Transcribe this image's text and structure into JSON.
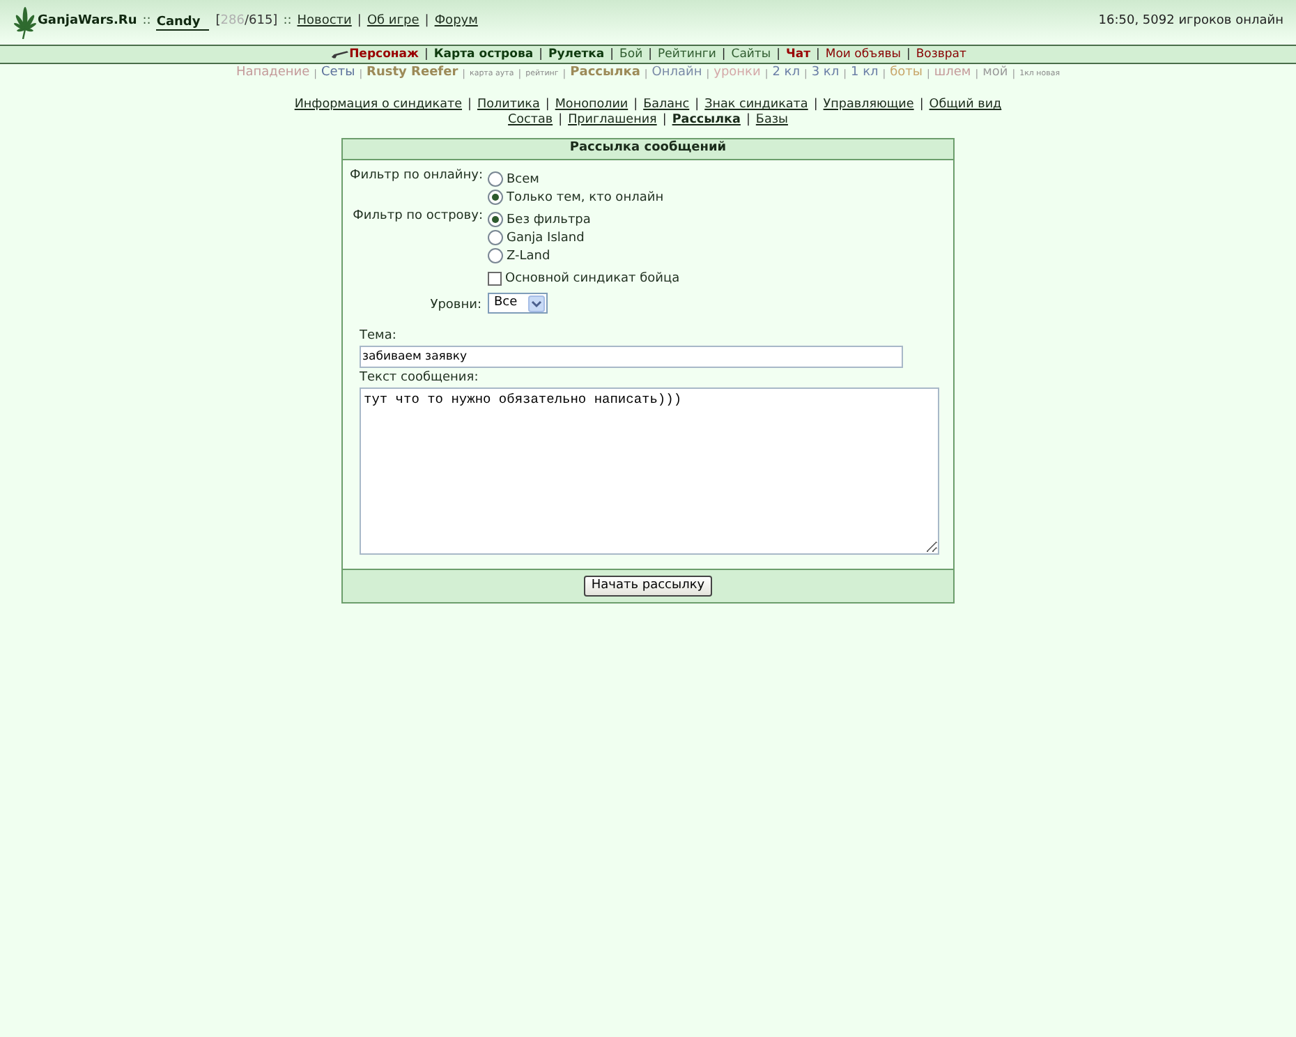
{
  "header": {
    "site_name": "GanjaWars.Ru",
    "dividers": [
      "::",
      "::"
    ],
    "player": {
      "name": "Candy",
      "hp": {
        "open": "[",
        "current": "286",
        "rest": "/615]"
      }
    },
    "link_separator": "|",
    "links": [
      "Новости",
      "Об игре",
      "Форум"
    ],
    "status": "16:50, 5092 игроков онлайн"
  },
  "main_nav": {
    "separator": "|",
    "items": [
      {
        "label": "Персонаж",
        "bold": true,
        "color": "#990000"
      },
      {
        "label": "Карта острова",
        "bold": true,
        "color": "#0f3a0f"
      },
      {
        "label": "Рулетка",
        "bold": true,
        "color": "#0f3a0f"
      },
      {
        "label": "Бой",
        "bold": false,
        "color": "#2d5a2d"
      },
      {
        "label": "Рейтинги",
        "bold": false,
        "color": "#2d5a2d"
      },
      {
        "label": "Сайты",
        "bold": false,
        "color": "#2d5a2d"
      },
      {
        "label": "Чат",
        "bold": true,
        "color": "#990000"
      },
      {
        "label": "Мои объявы",
        "bold": false,
        "color": "#880000"
      },
      {
        "label": "Возврат",
        "bold": false,
        "color": "#880000"
      }
    ]
  },
  "sub_nav": {
    "separator": "|",
    "items": [
      {
        "label": "Нападение",
        "kind": "normal",
        "color": "#c49a9a"
      },
      {
        "label": "Сеты",
        "kind": "normal",
        "color": "#5a6f9a"
      },
      {
        "label": "Rusty Reefer",
        "kind": "bold",
        "color": "#9c8a58"
      },
      {
        "label": "карта аута",
        "kind": "small",
        "color": "#8a8a8a"
      },
      {
        "label": "рейтинг",
        "kind": "small",
        "color": "#8a8a8a"
      },
      {
        "label": "Рассылка",
        "kind": "bold",
        "color": "#9c8a58"
      },
      {
        "label": "Онлайн",
        "kind": "normal",
        "color": "#7a8aa6"
      },
      {
        "label": "уронки",
        "kind": "normal",
        "color": "#d4a8a8"
      },
      {
        "label": "2 кл",
        "kind": "normal",
        "color": "#6a7ea6"
      },
      {
        "label": "3 кл",
        "kind": "normal",
        "color": "#6a7ea6"
      },
      {
        "label": "1 кл",
        "kind": "normal",
        "color": "#6a7ea6"
      },
      {
        "label": "боты",
        "kind": "normal",
        "color": "#c8a66a"
      },
      {
        "label": "шлем",
        "kind": "normal",
        "color": "#c49a9a"
      },
      {
        "label": "мой",
        "kind": "normal",
        "color": "#9a9a9a"
      },
      {
        "label": "1кл новая",
        "kind": "small",
        "color": "#8a8a8a"
      }
    ]
  },
  "syndicate_menu": {
    "separator": "|",
    "lines": [
      {
        "links": [
          {
            "label": "Информация о синдикате",
            "selected": false
          },
          {
            "label": "Политика",
            "selected": false
          },
          {
            "label": "Монополии",
            "selected": false
          },
          {
            "label": "Баланс",
            "selected": false
          },
          {
            "label": "Знак синдиката",
            "selected": false
          },
          {
            "label": "Управляющие",
            "selected": false
          },
          {
            "label": "Общий вид",
            "selected": false
          }
        ]
      },
      {
        "links": [
          {
            "label": "Состав",
            "selected": false
          },
          {
            "label": "Приглашения",
            "selected": false
          },
          {
            "label": "Рассылка",
            "selected": true
          },
          {
            "label": "Базы",
            "selected": false
          }
        ]
      }
    ]
  },
  "form": {
    "title": "Рассылка сообщений",
    "filters": [
      {
        "label": "Фильтр по онлайну:",
        "options": [
          {
            "label": "Всем",
            "selected": false
          },
          {
            "label": "Только тем, кто онлайн",
            "selected": true
          }
        ]
      },
      {
        "label": "Фильтр по острову:",
        "options": [
          {
            "label": "Без фильтра",
            "selected": true
          },
          {
            "label": "Ganja Island",
            "selected": false
          },
          {
            "label": "Z-Land",
            "selected": false
          }
        ]
      }
    ],
    "main_syndicate": {
      "label": "Основной синдикат бойца",
      "checked": false
    },
    "levels": {
      "label": "Уровни:",
      "value": "Все"
    },
    "subject": {
      "label": "Тема:",
      "value": "забиваем заявку"
    },
    "message": {
      "label": "Текст сообщения:",
      "value": "тут что то нужно обязательно написать)))"
    },
    "submit": "Начать рассылку"
  }
}
